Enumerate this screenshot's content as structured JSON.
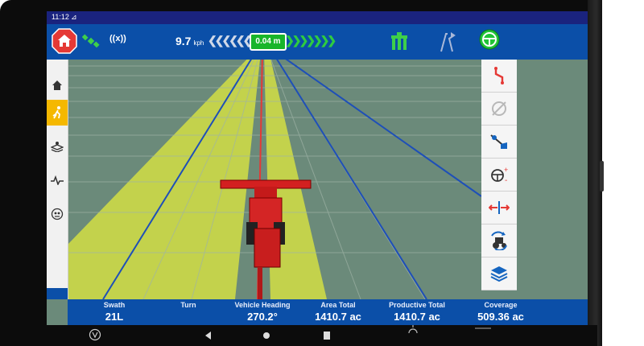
{
  "status_bar": {
    "time": "11:12",
    "nav_glyph": "⊿"
  },
  "top_bar": {
    "radio_signal": "((x))",
    "speed": "9.7",
    "speed_unit": "kph",
    "offset": "0.04 m",
    "left_chevrons": "❮❮❮❮❮❮❮",
    "right_chevrons": "❯❯❯❯❯❯❯"
  },
  "left_panel": {
    "items": [
      {
        "icon": "home-icon"
      },
      {
        "icon": "run-icon",
        "active": true
      },
      {
        "icon": "layers-icon"
      },
      {
        "icon": "pulse-icon"
      },
      {
        "icon": "gauge-icon"
      }
    ]
  },
  "right_panel": {
    "items": [
      {
        "icon": "path-icon"
      },
      {
        "icon": "steering-disabled-icon"
      },
      {
        "icon": "map-marker-flag-icon"
      },
      {
        "icon": "steering-wheel-adjust-icon"
      },
      {
        "icon": "nudge-arrows-icon"
      },
      {
        "icon": "tractor-rotate-icon"
      },
      {
        "icon": "layers-stack-icon"
      }
    ]
  },
  "bottom_bar": {
    "stats": [
      {
        "label": "Swath",
        "value": "21L"
      },
      {
        "label": "Turn",
        "value": ""
      },
      {
        "label": "Vehicle Heading",
        "value": "270.2°"
      },
      {
        "label": "Area Total",
        "value": "1410.7 ac"
      },
      {
        "label": "Productive Total",
        "value": "1410.7 ac"
      },
      {
        "label": "Coverage",
        "value": "509.36 ac"
      }
    ]
  },
  "colors": {
    "top_bar": "#0b4fa8",
    "field": "#6b8a7a",
    "coverage": "#c8d64a",
    "guidance_line": "#e53935",
    "guidance_lines": "#1e4fb8",
    "active_tab": "#f5b800",
    "accent_green": "#18b52a"
  }
}
